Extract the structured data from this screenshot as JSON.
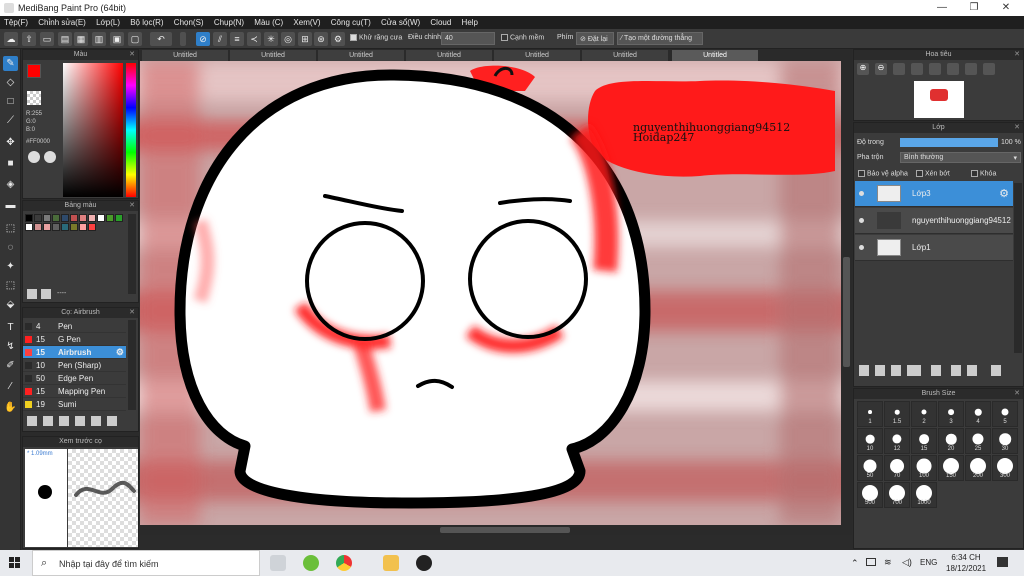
{
  "window": {
    "title": "MediBang Paint Pro (64bit)",
    "minimize": "—",
    "maximize": "❐",
    "close": "✕"
  },
  "menu": [
    "Tệp(F)",
    "Chỉnh sửa(E)",
    "Lớp(L)",
    "Bộ lọc(R)",
    "Chọn(S)",
    "Chụp(N)",
    "Màu (C)",
    "Xem(V)",
    "Công cụ(T)",
    "Cửa sổ(W)",
    "Cloud",
    "Help"
  ],
  "toolbar": {
    "antialias_label": "Khử răng cưa",
    "adjust_label": "Điều chỉnh",
    "adjust_value": "40",
    "smooth_label": "Cạnh mềm",
    "key_label": "Phím",
    "reset_label": "Đặt lại",
    "straight_line_label": "Tạo một đường thẳng"
  },
  "tabs": [
    "Untitled",
    "Untitled",
    "Untitled",
    "Untitled",
    "Untitled",
    "Untitled",
    "Untitled"
  ],
  "color_panel": {
    "title": "Màu",
    "r": "R:255",
    "g": "G:0",
    "b": "B:0",
    "hex": "#FF0000",
    "fg": "#ff0000",
    "bg": "#000000"
  },
  "palette_panel": {
    "title": "Bảng màu",
    "footer": "----"
  },
  "palette_colors": [
    "#000000",
    "#3c3c3c",
    "#7a7a7a",
    "#4a6b3a",
    "#2e4a6b",
    "#c05050",
    "#e08080",
    "#f0b0b0",
    "#ffffff",
    "#4a9a2a",
    "#2aa02a",
    "#ffffff",
    "#d09090",
    "#e8a0a0",
    "#606060",
    "#2a6a7a",
    "#7a7a2a",
    "#ffa0a0",
    "#ff4040"
  ],
  "brush_panel": {
    "title": "Cọ: Airbrush",
    "items": [
      {
        "size": "4",
        "name": "Pen",
        "color": "#2a2a2a"
      },
      {
        "size": "15",
        "name": "G Pen",
        "color": "#ff2020"
      },
      {
        "size": "15",
        "name": "Airbrush",
        "color": "#ff4040"
      },
      {
        "size": "10",
        "name": "Pen (Sharp)",
        "color": "#2a2a2a"
      },
      {
        "size": "50",
        "name": "Edge Pen",
        "color": "#2a2a2a"
      },
      {
        "size": "15",
        "name": "Mapping Pen",
        "color": "#ff2020"
      },
      {
        "size": "19",
        "name": "Sumi",
        "color": "#f0d020"
      }
    ]
  },
  "preview_panel": {
    "title": "Xem trước cọ",
    "size_text": "* 1.09mm"
  },
  "nav_panel": {
    "title": "Hoa tiêu"
  },
  "layer_panel": {
    "title": "Lớp",
    "opacity_label": "Độ trong",
    "opacity_value": "100 %",
    "opacity_fraction": 1.0,
    "blend_label": "Pha trộn",
    "blend_value": "Bình thường",
    "protect_alpha": "Bảo vệ alpha",
    "clipping": "Xén bớt",
    "lock": "Khóa",
    "layers": [
      {
        "name": "Lớp3",
        "selected": true
      },
      {
        "name": "nguyenthihuonggiang94512",
        "selected": false
      },
      {
        "name": "Lớp1",
        "selected": false
      }
    ]
  },
  "brush_size_panel": {
    "title": "Brush Size",
    "sizes": [
      "1",
      "1.5",
      "2",
      "3",
      "4",
      "5",
      "10",
      "12",
      "15",
      "20",
      "25",
      "30",
      "50",
      "70",
      "100",
      "150",
      "200",
      "300",
      "500",
      "700",
      "1000"
    ]
  },
  "canvas": {
    "watermark_line1": "nguyenthihuonggiang94512",
    "watermark_line2": "Hoidap247"
  },
  "taskbar": {
    "search_placeholder": "Nhập tại đây để tìm kiếm",
    "language": "ENG",
    "time": "6:34 CH",
    "date": "18/12/2021"
  }
}
